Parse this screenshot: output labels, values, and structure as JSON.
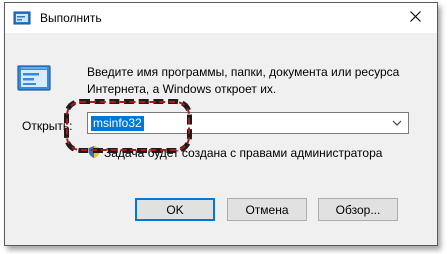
{
  "window": {
    "title": "Выполнить",
    "app_icon": "run-icon",
    "close_icon": "close-icon"
  },
  "description": {
    "line1": "Введите имя программы, папки, документа или ресурса",
    "line2": "Интернета, а Windows откроет их."
  },
  "open": {
    "label": "Открыть:",
    "value": "msinfo32",
    "dropdown_icon": "chevron-down-icon"
  },
  "admin_note": {
    "text": "Задача будет создана с правами администратора",
    "icon": "shield-icon"
  },
  "annotation": {
    "shape": "dashed-rounded-rectangle",
    "colors": [
      "#1c1c1c",
      "#b01818"
    ]
  },
  "buttons": {
    "ok": "OK",
    "cancel": "Отмена",
    "browse": "Обзор..."
  },
  "colors": {
    "accent": "#0078d7",
    "dialog_bg": "#f0f0f0"
  }
}
